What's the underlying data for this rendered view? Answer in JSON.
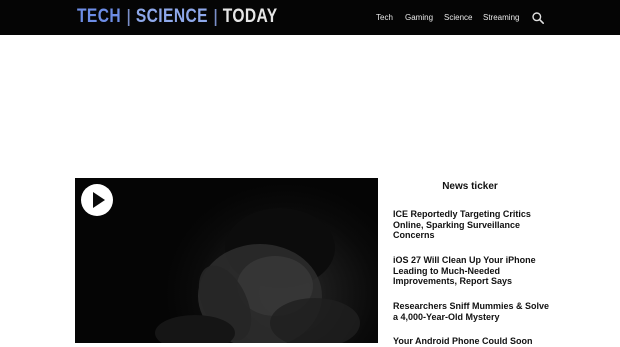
{
  "site": {
    "logo_parts": [
      "TECH",
      "SCIENCE",
      "TODAY"
    ]
  },
  "nav": {
    "items": [
      {
        "label": "Tech"
      },
      {
        "label": "Gaming"
      },
      {
        "label": "Science"
      },
      {
        "label": "Streaming"
      }
    ],
    "search_icon": "search-icon"
  },
  "video": {
    "play_icon": "play-icon"
  },
  "ticker": {
    "title": "News ticker",
    "items": [
      {
        "headline": "ICE Reportedly Targeting Critics Online, Sparking Surveillance Concerns"
      },
      {
        "headline": "iOS 27 Will Clean Up Your iPhone Leading to Much-Needed Improvements, Report Says"
      },
      {
        "headline": "Researchers Sniff Mummies & Solve a 4,000-Year-Old Mystery"
      },
      {
        "headline": "Your Android Phone Could Soon"
      }
    ]
  },
  "colors": {
    "header_bg": "#050505",
    "logo_accent": "#6d8de6",
    "text": "#111111"
  }
}
